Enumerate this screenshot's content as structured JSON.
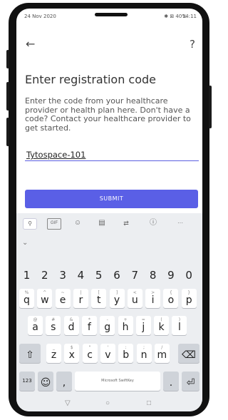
{
  "status_bar": {
    "date": "24 Nov 2020",
    "icons": "✱ ⊠ 40%",
    "time": "14:11"
  },
  "app_bar": {
    "back_icon": "←",
    "help_icon": "?"
  },
  "page": {
    "title": "Enter registration code",
    "description": "Enter the code from your healthcare provider or health plan here. Don't have a code? Contact your healthcare provider to get started.",
    "code_value": "Tytospace-101",
    "submit_label": "SUBMIT"
  },
  "keyboard": {
    "toolbar": [
      "search-icon",
      "gif-icon",
      "sticker-icon",
      "clipboard-icon",
      "translate-icon",
      "info-icon",
      "more-icon"
    ],
    "collapse_icon": "⌄",
    "number_row": [
      "1",
      "2",
      "3",
      "4",
      "5",
      "6",
      "7",
      "8",
      "9",
      "0"
    ],
    "row1": [
      {
        "k": "q",
        "a": "%"
      },
      {
        "k": "w",
        "a": "^"
      },
      {
        "k": "e",
        "a": "~"
      },
      {
        "k": "r",
        "a": "|"
      },
      {
        "k": "t",
        "a": "["
      },
      {
        "k": "y",
        "a": "]"
      },
      {
        "k": "u",
        "a": "<"
      },
      {
        "k": "i",
        "a": ">"
      },
      {
        "k": "o",
        "a": "{"
      },
      {
        "k": "p",
        "a": "}"
      }
    ],
    "row2": [
      {
        "k": "a",
        "a": "@"
      },
      {
        "k": "s",
        "a": "#"
      },
      {
        "k": "d",
        "a": "&"
      },
      {
        "k": "f",
        "a": "*"
      },
      {
        "k": "g",
        "a": "-"
      },
      {
        "k": "h",
        "a": "+"
      },
      {
        "k": "j",
        "a": "="
      },
      {
        "k": "k",
        "a": "("
      },
      {
        "k": "l",
        "a": ")"
      }
    ],
    "row3": [
      {
        "k": "z",
        "a": "_"
      },
      {
        "k": "x",
        "a": "$"
      },
      {
        "k": "c",
        "a": "\""
      },
      {
        "k": "v",
        "a": "'"
      },
      {
        "k": "b",
        "a": ":"
      },
      {
        "k": "n",
        "a": ";"
      },
      {
        "k": "m",
        "a": "/"
      }
    ],
    "shift_icon": "⇧",
    "backspace_icon": "⌫",
    "symbols_label": "123",
    "emoji_icon": "☺",
    "comma_label": ",",
    "space_label": "Microsoft SwiftKey",
    "period_label": ".",
    "enter_icon": "⏎"
  },
  "nav_bar": {
    "back": "▽",
    "home": "○",
    "recents": "□"
  }
}
